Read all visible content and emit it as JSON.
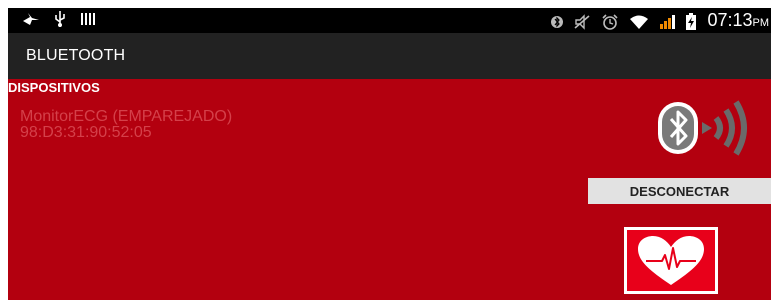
{
  "status_bar": {
    "time": "07:13",
    "ampm": "PM",
    "left_icons": [
      "notification-icon",
      "usb-icon",
      "barcode-icon"
    ],
    "right_icons": [
      "bluetooth-icon",
      "mute-icon",
      "alarm-icon",
      "wifi-icon",
      "signal-icon",
      "battery-icon"
    ]
  },
  "app_bar": {
    "title": "BLUETOOTH"
  },
  "devices": {
    "header": "DISPOSITIVOS",
    "items": [
      {
        "name": "MonitorECG (EMPAREJADO)",
        "mac": "98:D3:31:90:52:05"
      }
    ]
  },
  "actions": {
    "disconnect_label": "DESCONECTAR",
    "heart_icon": "heart-ecg-icon",
    "bluetooth_graphic": "bluetooth-signal-icon"
  },
  "colors": {
    "background": "#b3000f",
    "device_text": "#d4404a",
    "status_bar": "#000000",
    "app_bar": "#222222",
    "button": "#e2e2e2",
    "heart_button": "#e8001a"
  }
}
